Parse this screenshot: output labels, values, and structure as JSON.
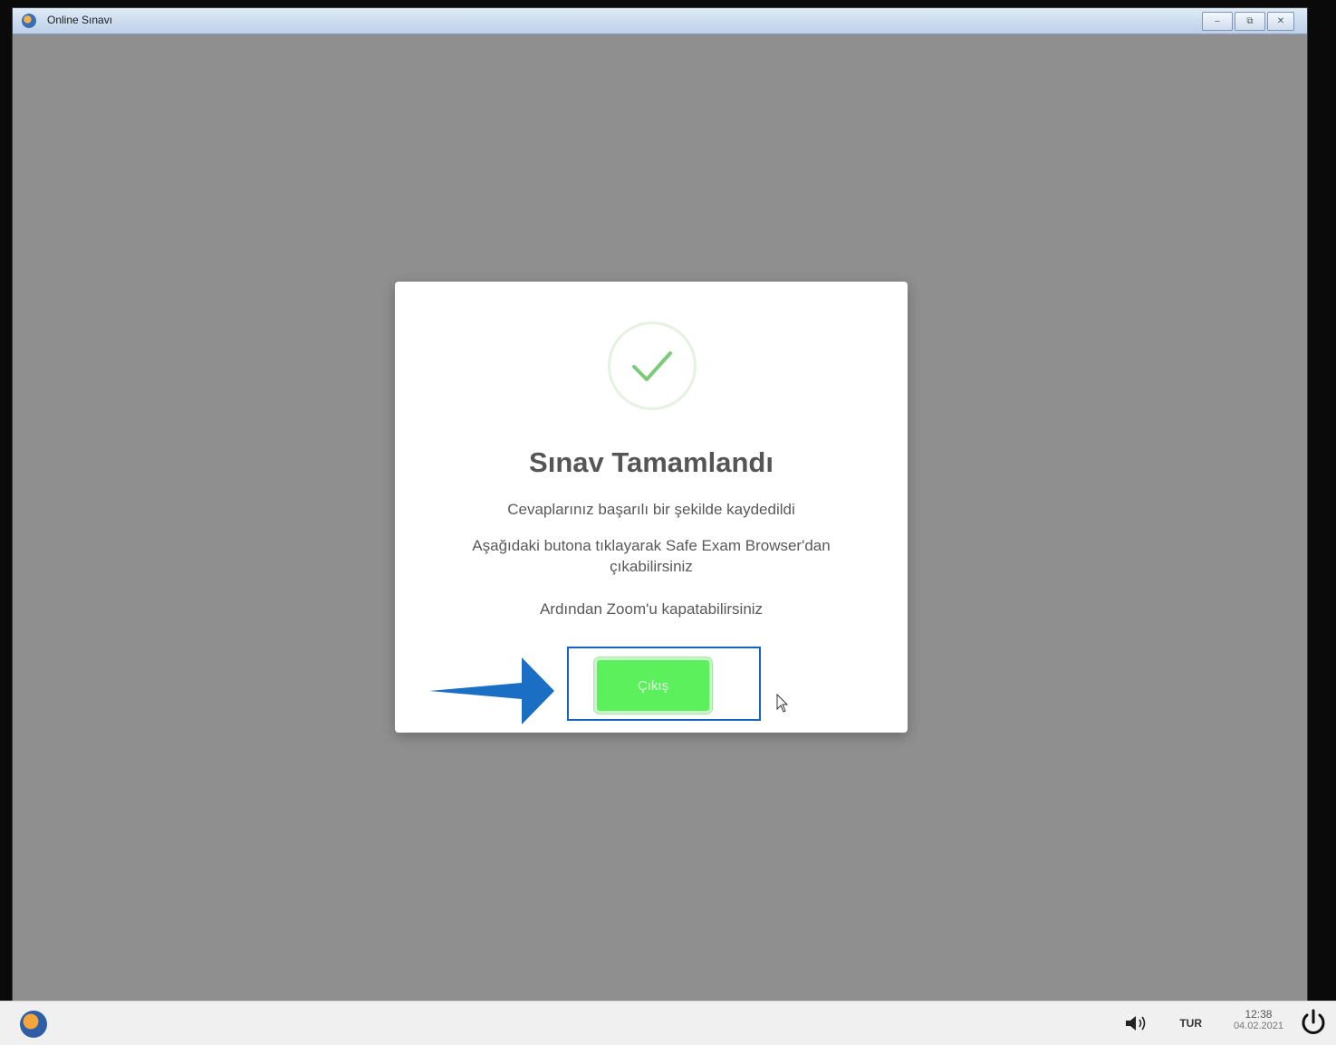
{
  "window": {
    "title": "Online Sınavı",
    "controls": {
      "minimize": "–",
      "restore": "⧉",
      "close": "✕"
    }
  },
  "dialog": {
    "title": "Sınav Tamamlandı",
    "lines": [
      "Cevaplarınız başarılı bir şekilde kaydedildi",
      "Aşağıdaki butona tıklayarak Safe Exam Browser'dan çıkabilirsiniz",
      "Ardından Zoom'u kapatabilirsiniz"
    ],
    "exit_button": "Çıkış",
    "icon": "check-circle-icon"
  },
  "taskbar": {
    "language": "TUR",
    "time": "12:38",
    "date": "04.02.2021"
  },
  "colors": {
    "overlay": "#8f8f8f",
    "exit_button": "#5cf05c",
    "highlight": "#1565c0",
    "check": "#7cc97a"
  }
}
